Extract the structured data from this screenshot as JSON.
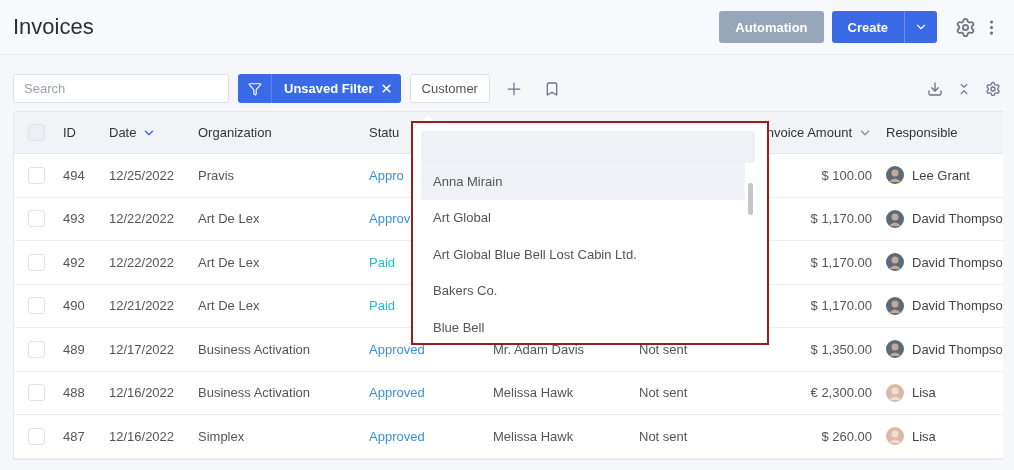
{
  "header": {
    "title": "Invoices",
    "buttons": [
      {
        "kind": "secondary",
        "label": "Automation"
      },
      {
        "kind": "split",
        "label": "Create"
      }
    ]
  },
  "toolbar": {
    "search": {
      "placeholder": "Search"
    },
    "filter": {
      "label": "Unsaved Filter"
    },
    "customer_button": {
      "label": "Customer"
    }
  },
  "table": {
    "select_all": {
      "checked": false
    },
    "columns": [
      {
        "label": "ID"
      },
      {
        "label": "Date",
        "sort_active": true
      },
      {
        "label": "Organization"
      },
      {
        "label": "Statu"
      },
      {
        "label": "nvoice Amount",
        "sort_active": false
      },
      {
        "label": "Responsible"
      }
    ],
    "rows": [
      {
        "checked": false,
        "id": "494",
        "date": "12/25/2022",
        "organization": "Pravis",
        "status": {
          "text": "Appro",
          "color": "#3b8fd9"
        },
        "amount": "$ 100.00",
        "responsible": "Lee Grant"
      },
      {
        "checked": false,
        "id": "493",
        "date": "12/22/2022",
        "organization": "Art De Lex",
        "status": {
          "text": "Approv",
          "color": "#3b8fd9"
        },
        "amount": "$ 1,170.00",
        "responsible": "David Thompso"
      },
      {
        "checked": false,
        "id": "492",
        "date": "12/22/2022",
        "organization": "Art De Lex",
        "status": {
          "text": "Paid",
          "color": "#2bb8d4"
        },
        "amount": "$ 1,170.00",
        "responsible": "David Thompso"
      },
      {
        "checked": false,
        "id": "490",
        "date": "12/21/2022",
        "organization": "Art De Lex",
        "status": {
          "text": "Paid",
          "color": "#2bb8d4"
        },
        "amount": "$ 1,170.00",
        "responsible": "David Thompso"
      },
      {
        "checked": false,
        "id": "489",
        "date": "12/17/2022",
        "organization": "Business Activation",
        "status": {
          "text": "Approved",
          "color": "#3b8fd9"
        },
        "customer": "Mr. Adam Davis",
        "sending": "Not sent",
        "amount": "$ 1,350.00",
        "responsible": "David Thompso"
      },
      {
        "checked": false,
        "id": "488",
        "date": "12/16/2022",
        "organization": "Business Activation",
        "status": {
          "text": "Approved",
          "color": "#3b8fd9"
        },
        "customer": "Melissa Hawk",
        "sending": "Not sent",
        "amount": "€ 2,300.00",
        "responsible": "Lisa"
      },
      {
        "checked": false,
        "id": "487",
        "date": "12/16/2022",
        "organization": "Simplex",
        "status": {
          "text": "Approved",
          "color": "#3b8fd9"
        },
        "customer": "Melissa Hawk",
        "sending": "Not sent",
        "amount": "$ 260.00",
        "responsible": "Lisa"
      }
    ]
  },
  "dropdown": {
    "items": [
      {
        "label": "Anna Mirain",
        "selected": true
      },
      {
        "label": "Art Global",
        "selected": false
      },
      {
        "label": "Art Global Blue Bell Lost Cabin Ltd.",
        "selected": false
      },
      {
        "label": "Bakers Co.",
        "selected": false
      },
      {
        "label": "Blue Bell",
        "selected": false
      }
    ]
  }
}
